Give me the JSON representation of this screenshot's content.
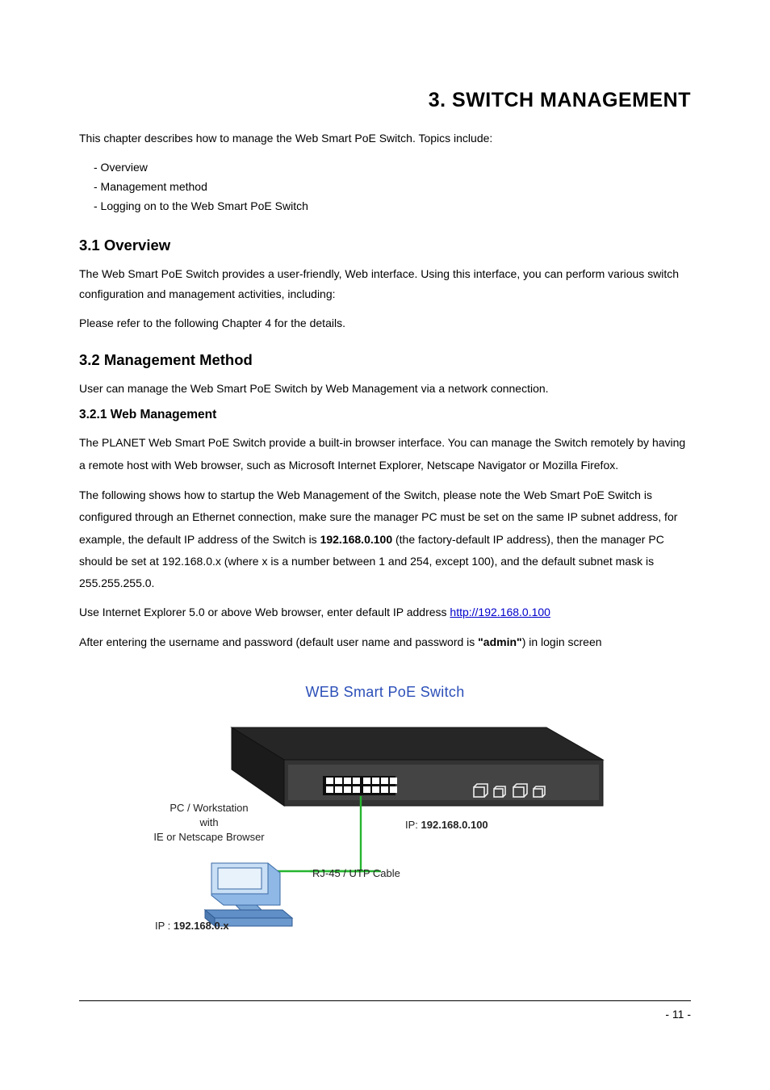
{
  "chapter_title": "3.  SWITCH MANAGEMENT",
  "intro": "This chapter describes how to manage the Web Smart PoE Switch. Topics include:",
  "bullets": {
    "b1": "- Overview",
    "b2": "- Management method",
    "b3": "- Logging on to the Web Smart PoE Switch"
  },
  "s31": {
    "heading": "3.1 Overview",
    "p1": "The Web Smart PoE Switch provides a user-friendly, Web interface. Using this interface, you can perform various switch configuration and management activities, including:",
    "p2": "Please refer to the following Chapter 4 for the details."
  },
  "s32": {
    "heading": "3.2 Management Method",
    "p1": "User can manage the Web Smart PoE Switch by Web Management via a network connection."
  },
  "s321": {
    "heading": "3.2.1 Web Management",
    "p1": "The PLANET Web Smart PoE Switch provide a built-in browser interface. You can manage the Switch remotely by having a remote host with Web browser, such as Microsoft Internet Explorer, Netscape Navigator or Mozilla Firefox.",
    "p2a": "The following shows how to startup the Web Management of the Switch, please note the Web Smart PoE Switch is configured through an Ethernet connection, make sure the manager PC must be set on the same IP subnet address, for example, the default IP address of the Switch is ",
    "p2_ip": "192.168.0.100",
    "p2b": " (the factory-default IP address), then the manager PC should be set at 192.168.0.x (where x is a number between 1 and 254, except 100), and the default subnet mask is 255.255.255.0.",
    "p3a": "Use Internet Explorer 5.0 or above Web browser, enter default IP address ",
    "p3_link": "http://192.168.0.100",
    "p4a": "After entering the username and password (default user name and password is ",
    "p4_admin": "\"admin\"",
    "p4b": ") in login screen"
  },
  "figure": {
    "title": "WEB Smart PoE Switch",
    "pc_label_l1": "PC / Workstation",
    "pc_label_l2": "with",
    "pc_label_l3": "IE or Netscape Browser",
    "switch_ip_prefix": "IP: ",
    "switch_ip": "192.168.0.100",
    "cable_label": "RJ-45 / UTP Cable",
    "pc_ip_prefix": "IP : ",
    "pc_ip": "192.168.0.x"
  },
  "page_number": "- 11 -"
}
